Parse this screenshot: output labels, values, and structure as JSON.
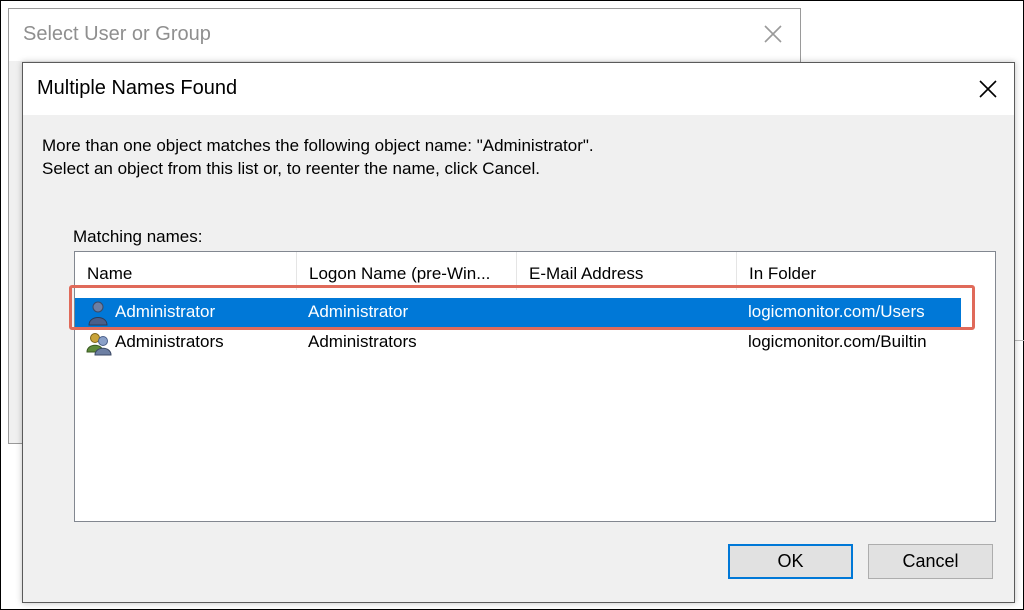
{
  "background_dialog": {
    "title": "Select User or Group"
  },
  "dialog": {
    "title": "Multiple Names Found",
    "message_line1": "More than one object matches the following object name: \"Administrator\".",
    "message_line2": "Select an object from this list or, to reenter the name, click Cancel.",
    "matching_label": "Matching names:",
    "columns": [
      "Name",
      "Logon Name (pre-Win...",
      "E-Mail Address",
      "In Folder"
    ],
    "rows": [
      {
        "icon": "user-icon",
        "name": "Administrator",
        "logon": "Administrator",
        "email": "",
        "folder": "logicmonitor.com/Users",
        "selected": true
      },
      {
        "icon": "group-icon",
        "name": "Administrators",
        "logon": "Administrators",
        "email": "",
        "folder": "logicmonitor.com/Builtin",
        "selected": false
      }
    ],
    "ok_label": "OK",
    "cancel_label": "Cancel"
  },
  "colors": {
    "selection": "#0078d7",
    "highlight_box": "#e06a5a"
  }
}
